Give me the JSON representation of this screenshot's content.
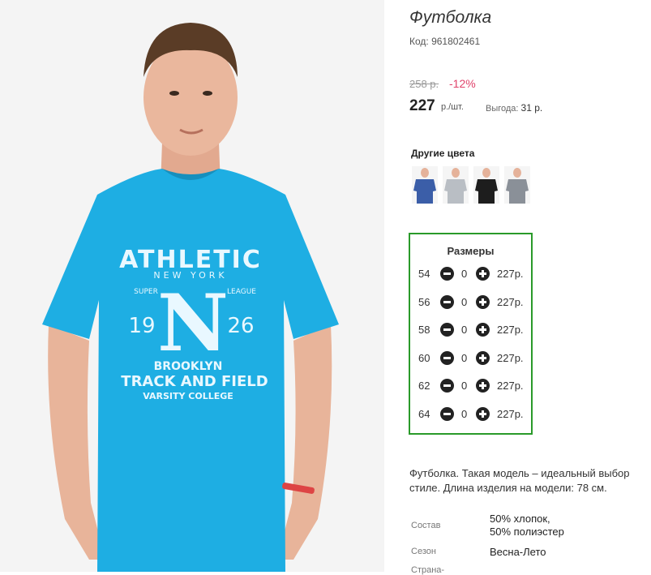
{
  "product": {
    "title": "Футболка",
    "code": "Код: 961802461",
    "old_price": "258 р.",
    "discount": "-12%",
    "price": "227",
    "price_unit": "р./шт.",
    "benefit_label": "Выгода:",
    "benefit_value": "31 р."
  },
  "photo": {
    "shirt_color": "#1eaee3",
    "print_lines": [
      "ATHLETIC",
      "NEW YORK",
      "SUPER",
      "LEAGUE",
      "19",
      "N",
      "26",
      "BROOKLYN",
      "TRACK AND FIELD",
      "VARSITY COLLEGE"
    ]
  },
  "colors": {
    "title": "Другие цвета",
    "items": [
      {
        "name": "blue",
        "hex": "#3b5ea8"
      },
      {
        "name": "light-gray",
        "hex": "#b9bec4"
      },
      {
        "name": "black",
        "hex": "#1d1d1d"
      },
      {
        "name": "gray",
        "hex": "#8a9098"
      }
    ]
  },
  "sizes": {
    "title": "Размеры",
    "rows": [
      {
        "size": "54",
        "qty": "0",
        "price": "227р."
      },
      {
        "size": "56",
        "qty": "0",
        "price": "227р."
      },
      {
        "size": "58",
        "qty": "0",
        "price": "227р."
      },
      {
        "size": "60",
        "qty": "0",
        "price": "227р."
      },
      {
        "size": "62",
        "qty": "0",
        "price": "227р."
      },
      {
        "size": "64",
        "qty": "0",
        "price": "227р."
      }
    ]
  },
  "description": {
    "line1": "Футболка. Такая модель – идеальный выбор",
    "line2": "стиле. Длина изделия на модели: 78 см."
  },
  "properties": [
    {
      "label": "Состав",
      "value_lines": [
        "50% хлопок,",
        "50% полиэстер"
      ]
    },
    {
      "label": "Сезон",
      "value_lines": [
        "Весна-Лето"
      ]
    },
    {
      "label": "Страна-",
      "value_lines": []
    }
  ]
}
